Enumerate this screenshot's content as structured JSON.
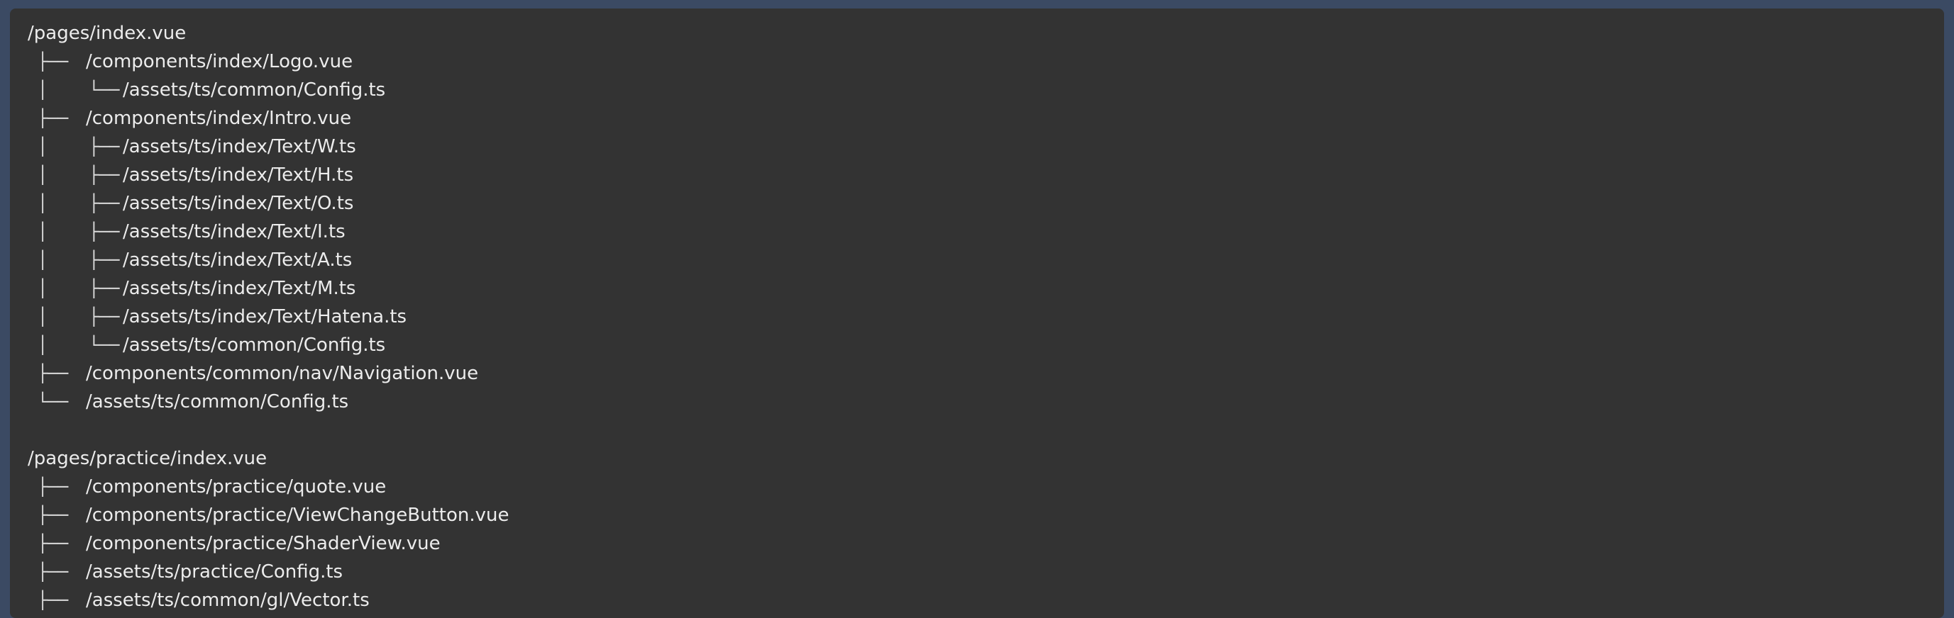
{
  "tree_lines": [
    {
      "prefix": "",
      "text": "/pages/index.vue"
    },
    {
      "prefix": "├──",
      "text": "/components/index/Logo.vue"
    },
    {
      "prefix": "│    └──",
      "text": "/assets/ts/common/Config.ts"
    },
    {
      "prefix": "├──",
      "text": "/components/index/Intro.vue"
    },
    {
      "prefix": "│    ├──",
      "text": "/assets/ts/index/Text/W.ts"
    },
    {
      "prefix": "│    ├──",
      "text": "/assets/ts/index/Text/H.ts"
    },
    {
      "prefix": "│    ├──",
      "text": "/assets/ts/index/Text/O.ts"
    },
    {
      "prefix": "│    ├──",
      "text": "/assets/ts/index/Text/I.ts"
    },
    {
      "prefix": "│    ├──",
      "text": "/assets/ts/index/Text/A.ts"
    },
    {
      "prefix": "│    ├──",
      "text": "/assets/ts/index/Text/M.ts"
    },
    {
      "prefix": "│    ├──",
      "text": "/assets/ts/index/Text/Hatena.ts"
    },
    {
      "prefix": "│    └──",
      "text": "/assets/ts/common/Config.ts"
    },
    {
      "prefix": "├──",
      "text": "/components/common/nav/Navigation.vue"
    },
    {
      "prefix": "└──",
      "text": "/assets/ts/common/Config.ts"
    },
    {
      "prefix": "",
      "text": ""
    },
    {
      "prefix": "",
      "text": "/pages/practice/index.vue"
    },
    {
      "prefix": "├──",
      "text": "/components/practice/quote.vue"
    },
    {
      "prefix": "├──",
      "text": "/components/practice/ViewChangeButton.vue"
    },
    {
      "prefix": "├──",
      "text": "/components/practice/ShaderView.vue"
    },
    {
      "prefix": "├──",
      "text": "/assets/ts/practice/Config.ts"
    },
    {
      "prefix": "├──",
      "text": "/assets/ts/common/gl/Vector.ts"
    }
  ]
}
